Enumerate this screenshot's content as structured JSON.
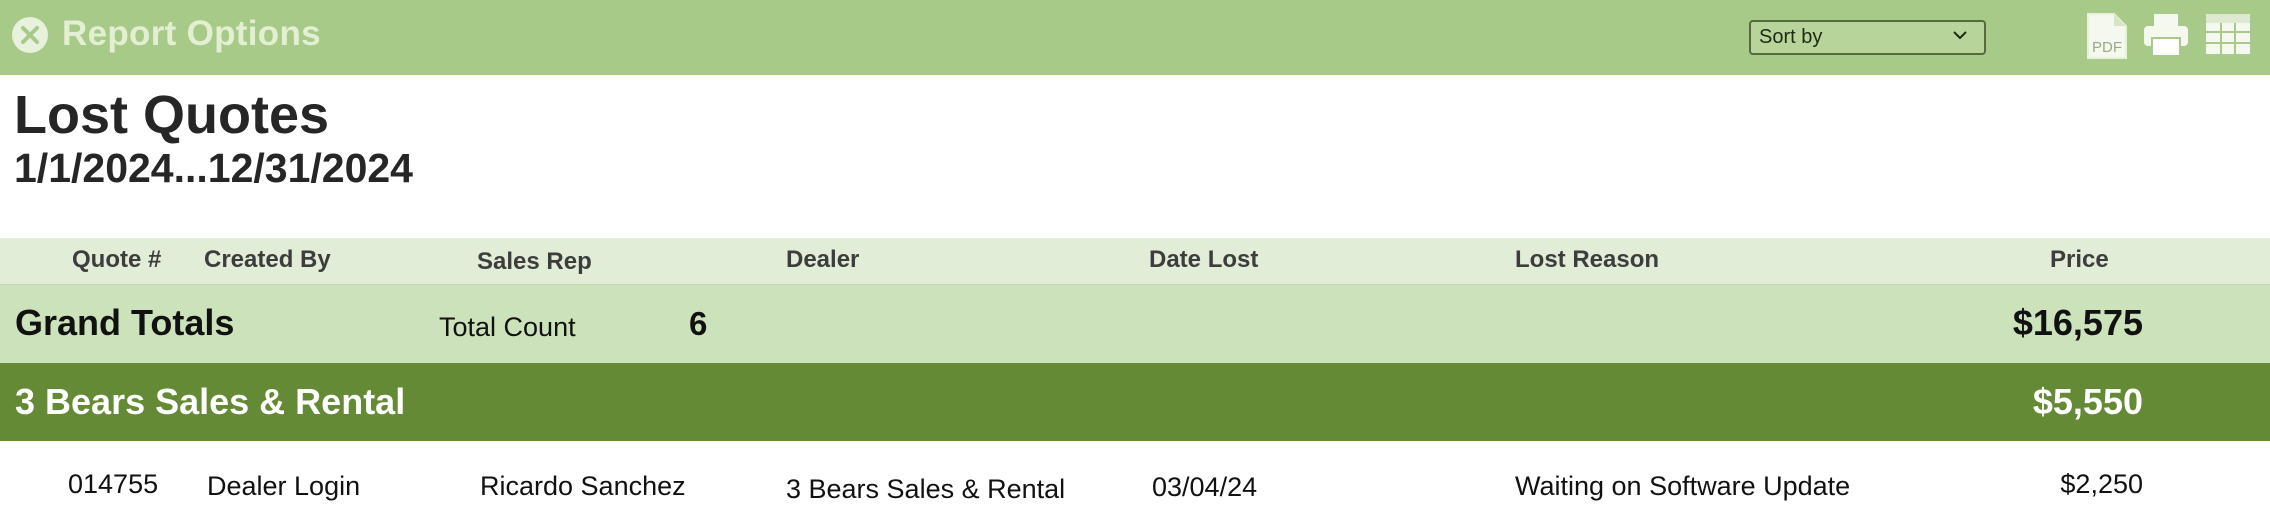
{
  "topbar": {
    "title": "Report Options",
    "sort_label": "Sort by"
  },
  "report": {
    "title": "Lost Quotes",
    "date_range": "1/1/2024...12/31/2024"
  },
  "columns": {
    "quote": "Quote #",
    "created_by": "Created By",
    "sales_rep": "Sales Rep",
    "dealer": "Dealer",
    "date_lost": "Date Lost",
    "lost_reason": "Lost Reason",
    "price": "Price"
  },
  "grand_totals": {
    "label": "Grand Totals",
    "count_label": "Total Count",
    "count": "6",
    "total": "$16,575"
  },
  "group": {
    "name": "3 Bears Sales & Rental",
    "total": "$5,550"
  },
  "rows": [
    {
      "quote": "014755",
      "created_by": "Dealer Login",
      "sales_rep": "Ricardo Sanchez",
      "dealer": "3 Bears Sales & Rental",
      "date_lost": "03/04/24",
      "lost_reason": "Waiting on Software Update",
      "price": "$2,250"
    }
  ],
  "icons": {
    "close": "close-circle-icon",
    "pdf": "pdf-icon",
    "print": "printer-icon",
    "table": "table-grid-icon"
  },
  "colors": {
    "topbar": "#a8ca88",
    "header_row": "#e1edd7",
    "grand_totals_row": "#cce2bb",
    "group_row": "#648a35"
  }
}
